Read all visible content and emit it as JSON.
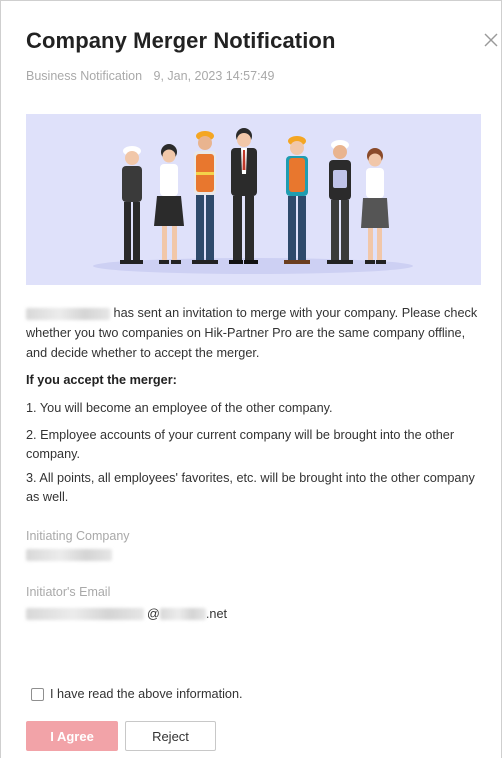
{
  "dialog": {
    "title": "Company Merger Notification",
    "close_icon": "close-icon"
  },
  "meta": {
    "category": "Business Notification",
    "timestamp": "9, Jan, 2023 14:57:49"
  },
  "banner": {
    "icon": "team-illustration",
    "background": "#dfe1fa"
  },
  "intro": {
    "text": "has sent an invitation to merge with your company. Please check whether you two companies on Hik-Partner Pro are the same company offline, and decide whether to accept the merger."
  },
  "accept_section": {
    "heading": "If you accept the merger:",
    "points": [
      "1. You will become an employee of the other company.",
      "2. Employee accounts of your current company will be brought into the other company.",
      "3. All points, all employees' favorites, etc. will be brought into the other company as well."
    ]
  },
  "fields": {
    "initiating_company_label": "Initiating Company",
    "initiator_email_label": "Initiator's Email",
    "email_at": "@",
    "email_tld": ".net"
  },
  "agreement": {
    "checkbox_label": "I have read the above information.",
    "checked": false
  },
  "actions": {
    "agree_label": "I Agree",
    "reject_label": "Reject",
    "agree_color": "#f2a3a8"
  }
}
